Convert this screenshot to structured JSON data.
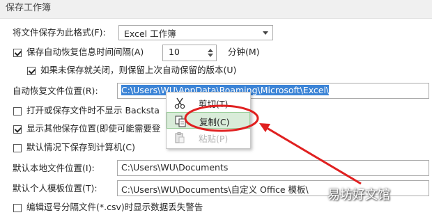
{
  "section": {
    "title": "保存工作簿"
  },
  "format_row": {
    "label": "将文件保存为此格式(F):",
    "value": "Excel 工作簿"
  },
  "autorecover_row": {
    "label": "保存自动恢复信息时间间隔(A)",
    "checked": true,
    "interval": "10",
    "unit": "分钟(M)"
  },
  "keep_last_row": {
    "label": "如果未保存就关闭，则保留上次自动保留的版本(U)",
    "checked": true
  },
  "autorecover_location": {
    "label": "自动恢复文件位置(R):",
    "path": "C:\\Users\\WU\\AppData\\Roaming\\Microsoft\\Excel\\"
  },
  "backstage_row": {
    "label": "打开或保存文件时不显示 Backsta",
    "checked": false
  },
  "other_locations_row": {
    "label": "显示其他保存位置(即使可能需要登",
    "checked": true
  },
  "default_computer_row": {
    "label": "默认情况下保存到计算机(C)",
    "checked": false
  },
  "default_local_row": {
    "label": "默认本地文件位置(I):",
    "path": "C:\\Users\\WU\\Documents"
  },
  "template_row": {
    "label": "默认个人模板位置(T):",
    "path": "C:\\Users\\WU\\Documents\\自定义 Office 模板\\"
  },
  "csv_row": {
    "label": "编辑逗号分隔文件(*.csv)时显示数据丢失警告",
    "checked": false
  },
  "context_menu": {
    "items": [
      {
        "label": "剪切(T)",
        "icon": "scissors-icon",
        "state": "normal"
      },
      {
        "label": "复制(C)",
        "icon": "copy-icon",
        "state": "active"
      },
      {
        "label": "粘贴(P)",
        "icon": "paste-icon",
        "state": "disabled"
      }
    ]
  },
  "annotation_color": "#e02020",
  "watermark": {
    "text": "易坊好文馆"
  }
}
